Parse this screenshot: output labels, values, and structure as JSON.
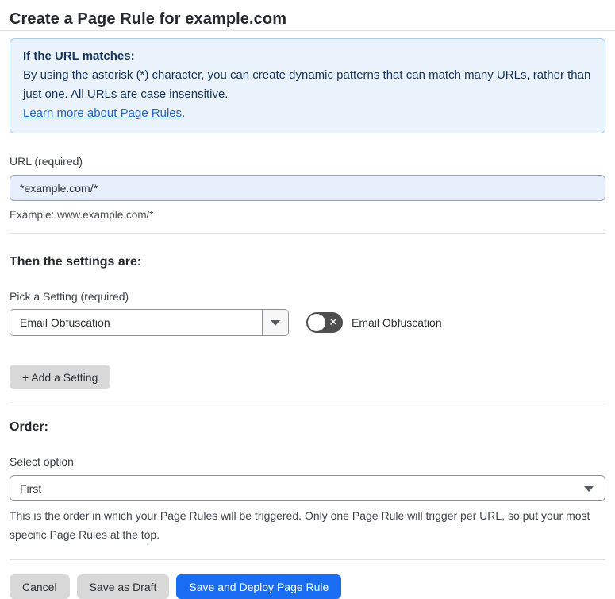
{
  "colors": {
    "accent_blue": "#1b6ef3",
    "info_background": "#eaf3fb",
    "info_border": "#abccea",
    "info_text": "#17365f",
    "link_blue": "#2563cf",
    "url_input_background": "#e6edfb",
    "toggle_off_background": "#4f4f4f",
    "gray_button_background": "#d8d8d8"
  },
  "header": {
    "title": "Create a Page Rule for example.com"
  },
  "info_box": {
    "heading": "If the URL matches:",
    "body": "By using the asterisk (*) character, you can create dynamic patterns that can match many URLs, rather than just one. All URLs are case insensitive.",
    "link_label": "Learn more about Page Rules",
    "link_suffix": "."
  },
  "url_field": {
    "label": "URL (required)",
    "value": "*example.com/*",
    "example": "Example: www.example.com/*"
  },
  "settings": {
    "heading": "Then the settings are:",
    "picker_label": "Pick a Setting (required)",
    "selected_setting": "Email Obfuscation",
    "toggle": {
      "state": "off",
      "icon": "x-icon",
      "label": "Email Obfuscation"
    },
    "add_button_label": "+ Add a Setting"
  },
  "order": {
    "heading": "Order:",
    "select_label": "Select option",
    "selected_option": "First",
    "help_text": "This is the order in which your Page Rules will be triggered. Only one Page Rule will trigger per URL, so put your most specific Page Rules at the top."
  },
  "footer": {
    "cancel_label": "Cancel",
    "save_draft_label": "Save as Draft",
    "save_deploy_label": "Save and Deploy Page Rule"
  }
}
